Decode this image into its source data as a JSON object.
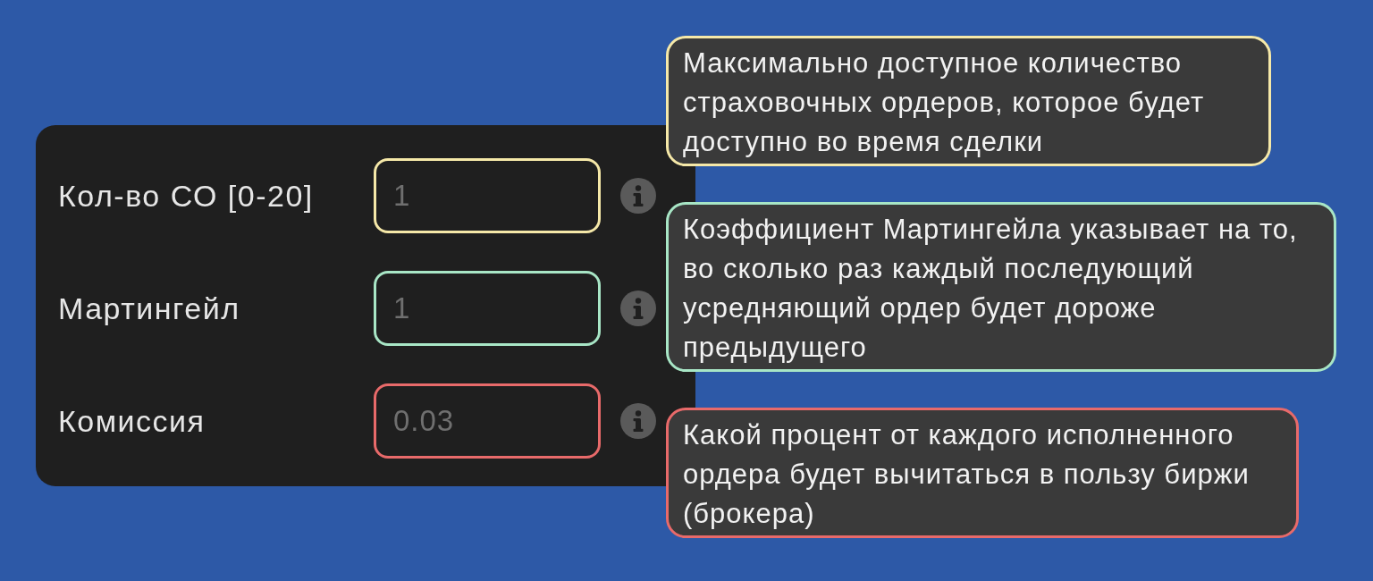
{
  "fields": [
    {
      "label": "Кол-во СО [0-20]",
      "placeholder": "1",
      "color": "#f5e8a8",
      "tooltip": "Максимально доступное количество страховочных ордеров, которое будет доступно во время сделки"
    },
    {
      "label": "Мартингейл",
      "placeholder": "1",
      "color": "#a8e6c6",
      "tooltip": "Коэффициент Мартингейла указывает на то, во сколько раз каждый последующий усредняющий ордер будет дороже предыдущего"
    },
    {
      "label": "Комиссия",
      "placeholder": "0.03",
      "color": "#e86a6a",
      "tooltip": "Какой процент от каждого исполненного ордера будет вычитаться в пользу биржи (брокера)"
    }
  ]
}
